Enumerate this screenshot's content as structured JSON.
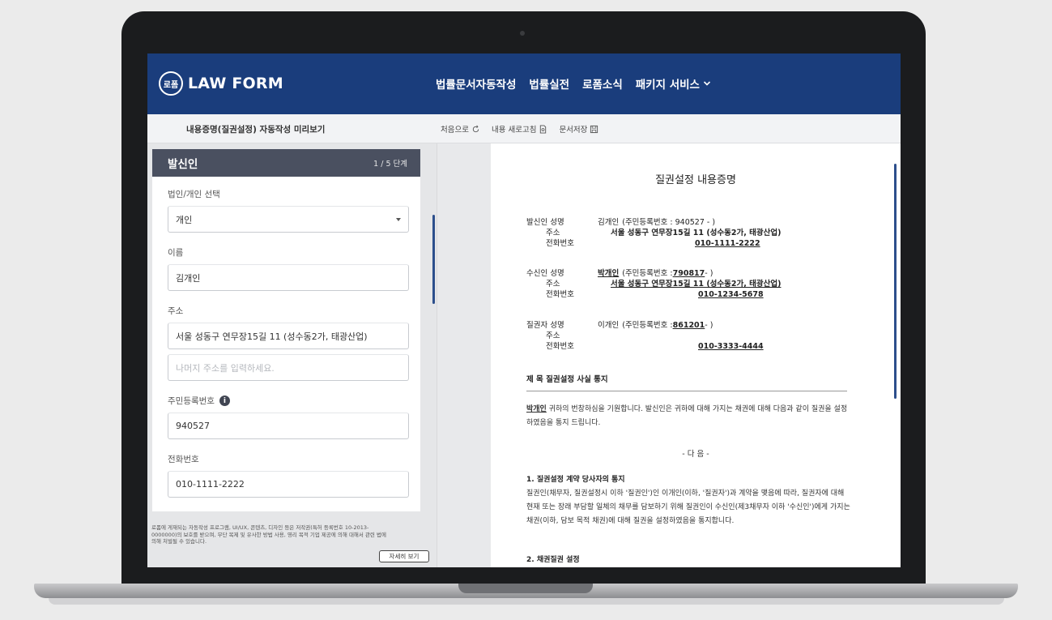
{
  "header": {
    "logo_mark": "로폼",
    "logo_text": "LAW FORM",
    "nav": [
      "법률문서자동작성",
      "법률실전",
      "로폼소식",
      "패키지 서비스"
    ]
  },
  "subbar": {
    "title": "내용증명(질권설정) 자동작성 미리보기",
    "actions": [
      "처음으로",
      "내용 새로고침",
      "문서저장"
    ]
  },
  "panel": {
    "title": "발신인",
    "step": "1 / 5 단계",
    "fields": {
      "type_label": "법인/개인 선택",
      "type_value": "개인",
      "name_label": "이름",
      "name_value": "김개인",
      "address_label": "주소",
      "address_value": "서울 성동구 연무장15길 11 (성수동2가, 태광산업)",
      "address_detail_placeholder": "나머지 주소를 입력하세요.",
      "rrn_label": "주민등록번호",
      "rrn_value": "940527",
      "phone_label": "전화번호",
      "phone_value": "010-1111-2222"
    }
  },
  "notice": {
    "text": "로폼에 게재되는 자동작성 프로그램, UI/UX, 콘텐츠, 디자인 등은 저작권(특허 등록번호 10-2013-0000000)의 보호를 받으며, 무단 복제 및 유사한 방법 사용, 영리 목적 기업 제공에 의해 대해서 관련 법에 의해 처벌될 수 있습니다.",
    "button": "자세히 보기"
  },
  "document": {
    "title": "질권설정 내용증명",
    "sender": {
      "name_key": "발신인 성명",
      "name": "김개인",
      "rrn": "(주민등록번호 : 940527 -          )",
      "addr_key": "주소",
      "addr": "서울 성동구 연무장15길 11 (성수동2가, 태광산업)",
      "phone_key": "전화번호",
      "phone": "010-1111-2222"
    },
    "receiver": {
      "name_key": "수신인 성명",
      "name": "박개인",
      "rrn_prefix": "(주민등록번호 : ",
      "rrn_num": "790817",
      "rrn_suffix": " -          )",
      "addr_key": "주소",
      "addr": "서울 성동구 연무장15길 11 (성수동2가, 태광산업)",
      "phone_key": "전화번호",
      "phone": "010-1234-5678"
    },
    "pledgor": {
      "name_key": "질권자 성명",
      "name": "이개인",
      "rrn_prefix": "(주민등록번호 : ",
      "rrn_num": "861201",
      "rrn_suffix": " -          )",
      "addr_key": "주소",
      "phone_key": "전화번호",
      "phone": "010-3333-4444"
    },
    "subject": "제   목   질권설정 사실 통지",
    "para1_name": "박개인",
    "para1": " 귀하의 번창하심을 기원합니다. 발신인은 귀하에 대해 가지는 채권에 대해 다음과 같이 질권을 설정하였음을 통지 드립니다.",
    "heading": "- 다   음 -",
    "sec1_title": "1. 질권설정 계약 당사자의 통지",
    "sec1_body": "질권인(채무자, 질권설정시 이하 '질권인')인 이개인(이하, '질권자')과 계약을 맺음에 따라, 질권자에 대해 현재 또는 장래 부담할 일체의 채무를 담보하기 위해 질권인이 수신인(제3채무자 이하 '수신인')에게 가지는 채권(이하, 담보 목적 채권)에 대해 질권을 설정하였음을 통지합니다.",
    "sec2_title": "2. 채권질권 설정"
  }
}
